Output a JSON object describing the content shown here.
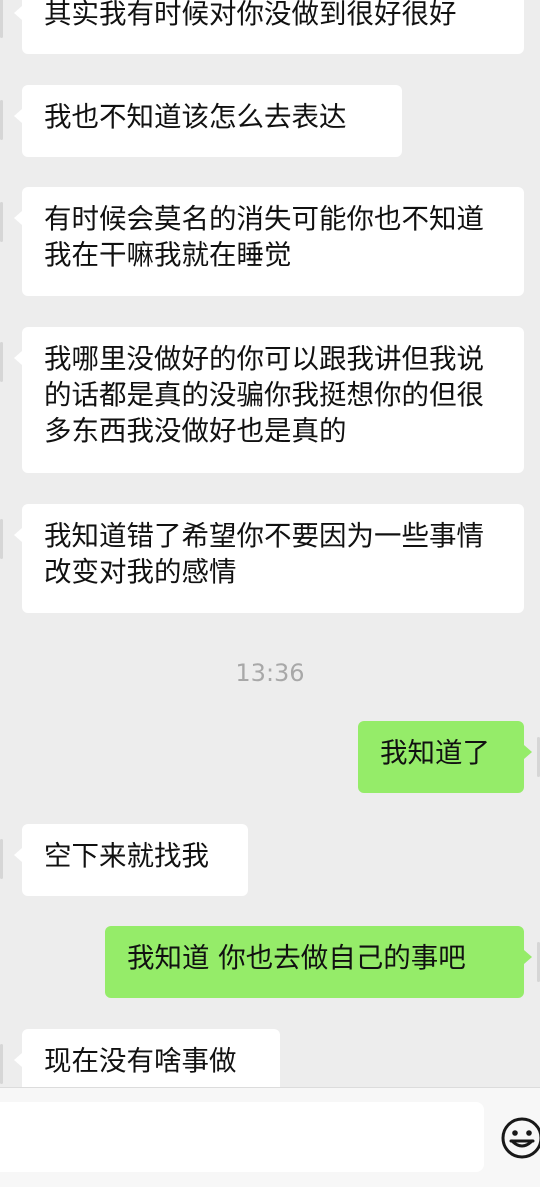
{
  "messages": [
    {
      "side": "in",
      "text": "其实我有时候对你没做到很好很好"
    },
    {
      "side": "in",
      "text": "我也不知道该怎么去表达"
    },
    {
      "side": "in",
      "text": "有时候会莫名的消失可能你也不知道我在干嘛我就在睡觉"
    },
    {
      "side": "in",
      "text": "我哪里没做好的你可以跟我讲但我说的话都是真的没骗你我挺想你的但很多东西我没做好也是真的"
    },
    {
      "side": "in",
      "text": "我知道错了希望你不要因为一些事情改变对我的感情"
    },
    {
      "side": "out",
      "text": "我知道了"
    },
    {
      "side": "in",
      "text": "空下来就找我"
    },
    {
      "side": "out",
      "text": "我知道 你也去做自己的事吧"
    },
    {
      "side": "in",
      "text": "现在没有啥事做"
    }
  ],
  "timestamp": "13:36",
  "input_bar": {
    "value": "",
    "emoji_icon": "smiley-face-icon"
  },
  "colors": {
    "background": "#ededed",
    "incoming_bubble": "#ffffff",
    "outgoing_bubble": "#95ec69"
  }
}
